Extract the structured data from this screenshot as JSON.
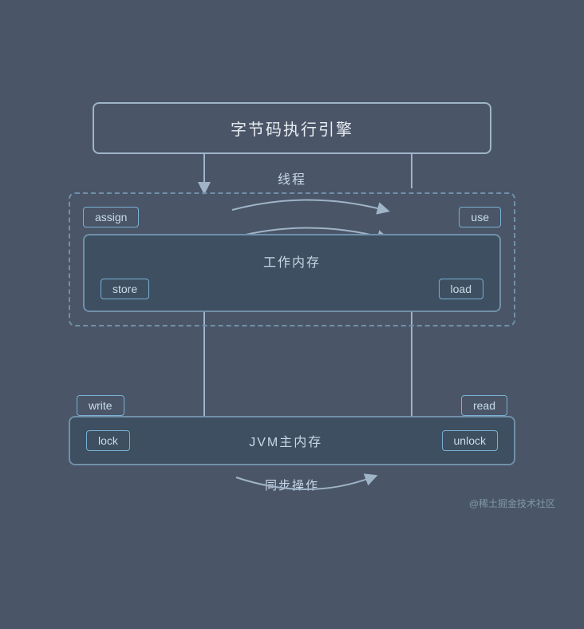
{
  "diagram": {
    "bytecode_engine": "字节码执行引擎",
    "thread_label": "线程",
    "assign_label": "assign",
    "use_label": "use",
    "store_label": "store",
    "load_label": "load",
    "working_memory_label": "工作内存",
    "write_label": "write",
    "read_label": "read",
    "lock_label": "lock",
    "unlock_label": "unlock",
    "jvm_main_memory_label": "JVM主内存",
    "sync_label": "同步操作",
    "watermark": "@稀土掘金技术社区",
    "colors": {
      "background": "#4a5568",
      "box_border": "#7090a8",
      "box_bg": "#3d4f60",
      "op_border": "#7ab0d4",
      "text": "#c8d8e8",
      "arrow": "#a0b4c8"
    }
  }
}
